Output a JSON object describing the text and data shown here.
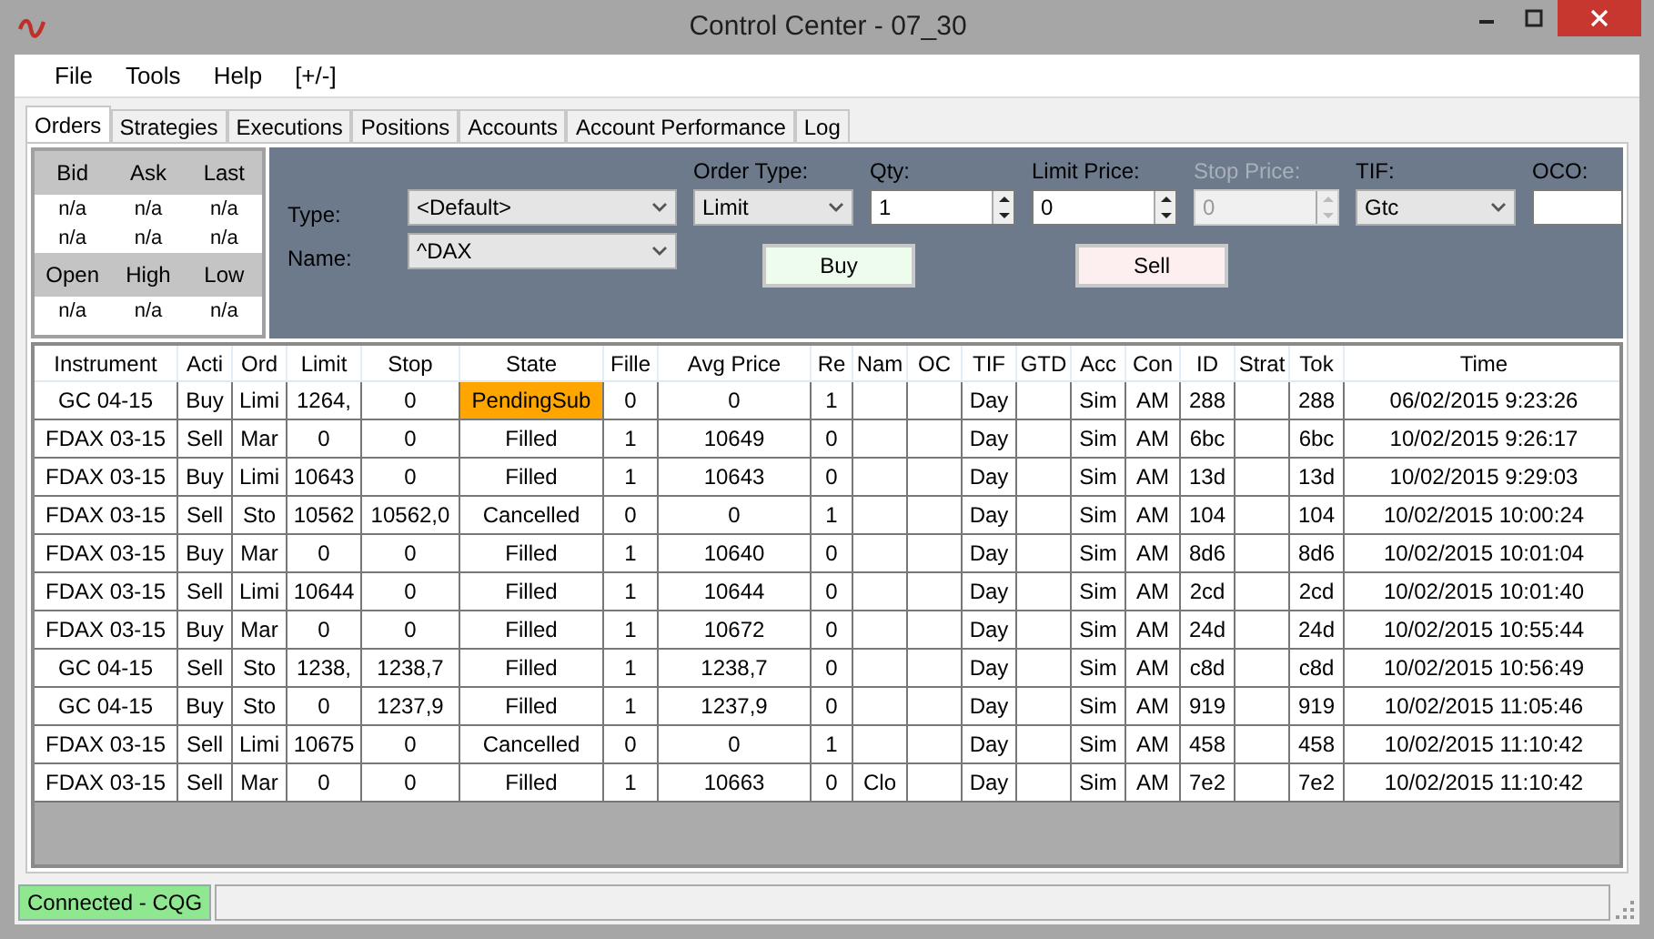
{
  "window": {
    "title": "Control Center - 07_30"
  },
  "menu": [
    "File",
    "Tools",
    "Help",
    "[+/-]"
  ],
  "tabs": [
    {
      "label": "Orders",
      "selected": true
    },
    {
      "label": "Strategies",
      "selected": false
    },
    {
      "label": "Executions",
      "selected": false
    },
    {
      "label": "Positions",
      "selected": false
    },
    {
      "label": "Accounts",
      "selected": false
    },
    {
      "label": "Account Performance",
      "selected": false
    },
    {
      "label": "Log",
      "selected": false
    }
  ],
  "quote": {
    "groups": [
      {
        "headers": [
          "Bid",
          "Ask",
          "Last"
        ],
        "rows": [
          [
            "n/a",
            "n/a",
            "n/a"
          ],
          [
            "n/a",
            "n/a",
            "n/a"
          ]
        ]
      },
      {
        "headers": [
          "Open",
          "High",
          "Low"
        ],
        "rows": [
          [
            "n/a",
            "n/a",
            "n/a"
          ]
        ]
      }
    ]
  },
  "order_entry": {
    "type": {
      "label": "Type:",
      "value": "<Default>"
    },
    "name": {
      "label": "Name:",
      "value": "^DAX"
    },
    "fields": [
      {
        "kind": "select",
        "label": "Order Type:",
        "value": "Limit",
        "disabled": false
      },
      {
        "kind": "spin",
        "label": "Qty:",
        "value": "1",
        "disabled": false
      },
      {
        "kind": "spin",
        "label": "Limit Price:",
        "value": "0",
        "disabled": false
      },
      {
        "kind": "spin",
        "label": "Stop Price:",
        "value": "0",
        "disabled": true
      },
      {
        "kind": "select",
        "label": "TIF:",
        "value": "Gtc",
        "disabled": false
      },
      {
        "kind": "text",
        "label": "OCO:",
        "disabled": false
      }
    ],
    "buy": "Buy",
    "sell": "Sell"
  },
  "table": {
    "columns": [
      "Instrument",
      "Acti",
      "Ord",
      "Limit",
      "Stop",
      "State",
      "Fille",
      "Avg Price",
      "Re",
      "Nam",
      "OC",
      "TIF",
      "GTD",
      "Acc",
      "Con",
      "ID",
      "Strat",
      "Tok",
      "Time"
    ],
    "rows": [
      {
        "highlight": true,
        "cells": [
          "GC 04-15",
          "Buy",
          "Limi",
          "1264,",
          "0",
          "PendingSub",
          "0",
          "0",
          "1",
          "",
          "",
          "Day",
          "",
          "Sim",
          "AM",
          "288",
          "",
          "288",
          "06/02/2015 9:23:26"
        ]
      },
      {
        "highlight": false,
        "cells": [
          "FDAX 03-15",
          "Sell",
          "Mar",
          "0",
          "0",
          "Filled",
          "1",
          "10649",
          "0",
          "",
          "",
          "Day",
          "",
          "Sim",
          "AM",
          "6bc",
          "",
          "6bc",
          "10/02/2015 9:26:17"
        ]
      },
      {
        "highlight": false,
        "cells": [
          "FDAX 03-15",
          "Buy",
          "Limi",
          "10643",
          "0",
          "Filled",
          "1",
          "10643",
          "0",
          "",
          "",
          "Day",
          "",
          "Sim",
          "AM",
          "13d",
          "",
          "13d",
          "10/02/2015 9:29:03"
        ]
      },
      {
        "highlight": false,
        "cells": [
          "FDAX 03-15",
          "Sell",
          "Sto",
          "10562",
          "10562,0",
          "Cancelled",
          "0",
          "0",
          "1",
          "",
          "",
          "Day",
          "",
          "Sim",
          "AM",
          "104",
          "",
          "104",
          "10/02/2015 10:00:24"
        ]
      },
      {
        "highlight": false,
        "cells": [
          "FDAX 03-15",
          "Buy",
          "Mar",
          "0",
          "0",
          "Filled",
          "1",
          "10640",
          "0",
          "",
          "",
          "Day",
          "",
          "Sim",
          "AM",
          "8d6",
          "",
          "8d6",
          "10/02/2015 10:01:04"
        ]
      },
      {
        "highlight": false,
        "cells": [
          "FDAX 03-15",
          "Sell",
          "Limi",
          "10644",
          "0",
          "Filled",
          "1",
          "10644",
          "0",
          "",
          "",
          "Day",
          "",
          "Sim",
          "AM",
          "2cd",
          "",
          "2cd",
          "10/02/2015 10:01:40"
        ]
      },
      {
        "highlight": false,
        "cells": [
          "FDAX 03-15",
          "Buy",
          "Mar",
          "0",
          "0",
          "Filled",
          "1",
          "10672",
          "0",
          "",
          "",
          "Day",
          "",
          "Sim",
          "AM",
          "24d",
          "",
          "24d",
          "10/02/2015 10:55:44"
        ]
      },
      {
        "highlight": false,
        "cells": [
          "GC 04-15",
          "Sell",
          "Sto",
          "1238,",
          "1238,7",
          "Filled",
          "1",
          "1238,7",
          "0",
          "",
          "",
          "Day",
          "",
          "Sim",
          "AM",
          "c8d",
          "",
          "c8d",
          "10/02/2015 10:56:49"
        ]
      },
      {
        "highlight": false,
        "cells": [
          "GC 04-15",
          "Buy",
          "Sto",
          "0",
          "1237,9",
          "Filled",
          "1",
          "1237,9",
          "0",
          "",
          "",
          "Day",
          "",
          "Sim",
          "AM",
          "919",
          "",
          "919",
          "10/02/2015 11:05:46"
        ]
      },
      {
        "highlight": false,
        "cells": [
          "FDAX 03-15",
          "Sell",
          "Limi",
          "10675",
          "0",
          "Cancelled",
          "0",
          "0",
          "1",
          "",
          "",
          "Day",
          "",
          "Sim",
          "AM",
          "458",
          "",
          "458",
          "10/02/2015 11:10:42"
        ]
      },
      {
        "highlight": false,
        "cells": [
          "FDAX 03-15",
          "Sell",
          "Mar",
          "0",
          "0",
          "Filled",
          "1",
          "10663",
          "0",
          "Clo",
          "",
          "Day",
          "",
          "Sim",
          "AM",
          "7e2",
          "",
          "7e2",
          "10/02/2015 11:10:42"
        ]
      }
    ]
  },
  "status_bar": {
    "connection": "Connected - CQG"
  }
}
